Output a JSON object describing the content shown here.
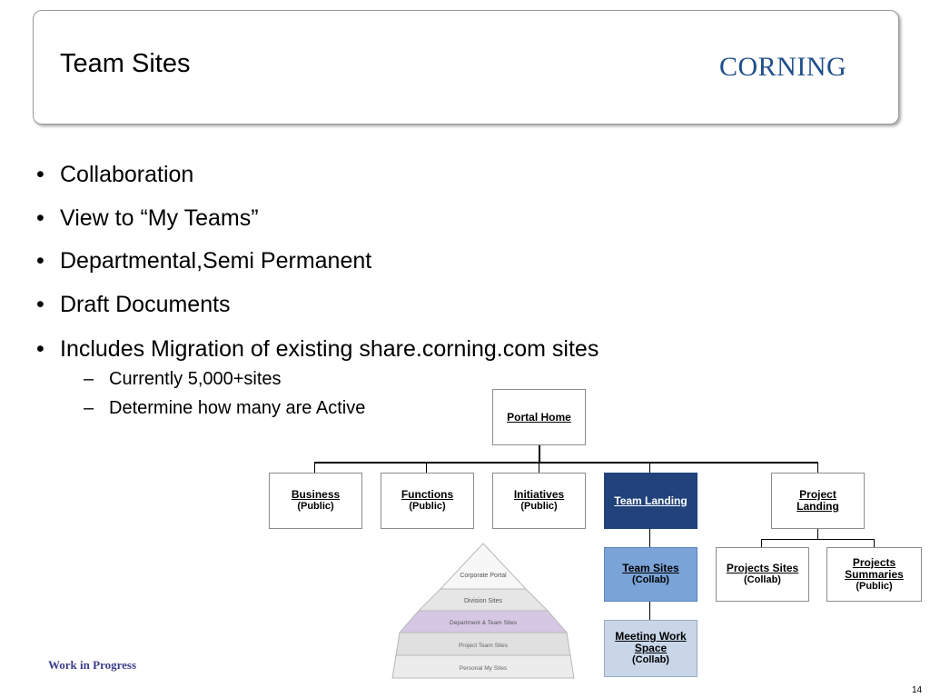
{
  "slide": {
    "title": "Team Sites",
    "logo_text": "CORNING",
    "footer_text": "Work in Progress",
    "page_number": "14"
  },
  "bullets": [
    "Collaboration",
    "View to “My Teams”",
    "Departmental,Semi Permanent",
    "Draft Documents",
    "Includes Migration of existing share.corning.com sites"
  ],
  "sub_bullets": [
    "Currently 5,000+sites",
    "Determine how many are Active"
  ],
  "diagram": {
    "portal_home": "Portal Home",
    "business": {
      "main": "Business",
      "sub": "(Public)"
    },
    "functions": {
      "main": "Functions",
      "sub": "(Public)"
    },
    "initiatives": {
      "main": "Initiatives",
      "sub": "(Public)"
    },
    "team_landing": "Team Landing",
    "project_landing": "Project Landing",
    "team_sites": {
      "main": "Team Sites",
      "sub": "(Collab)"
    },
    "projects_sites": {
      "main": "Projects Sites",
      "sub": "(Collab)"
    },
    "projects_summaries": {
      "main": "Projects Summaries",
      "sub": "(Public)"
    },
    "meeting_work_space": {
      "main": "Meeting Work Space",
      "sub": "(Collab)"
    }
  },
  "pyramid": {
    "levels": [
      "Corporate Portal",
      "Division Sites",
      "Department & Team Sites",
      "Project Team Sites",
      "Personal My Sites"
    ]
  },
  "colors": {
    "logo": "#1f4e8c",
    "team_landing": "#21427a",
    "team_sites": "#7aa3d8",
    "meeting_space": "#c8d6e8",
    "pyramid_highlight": "#d8c8e6"
  }
}
